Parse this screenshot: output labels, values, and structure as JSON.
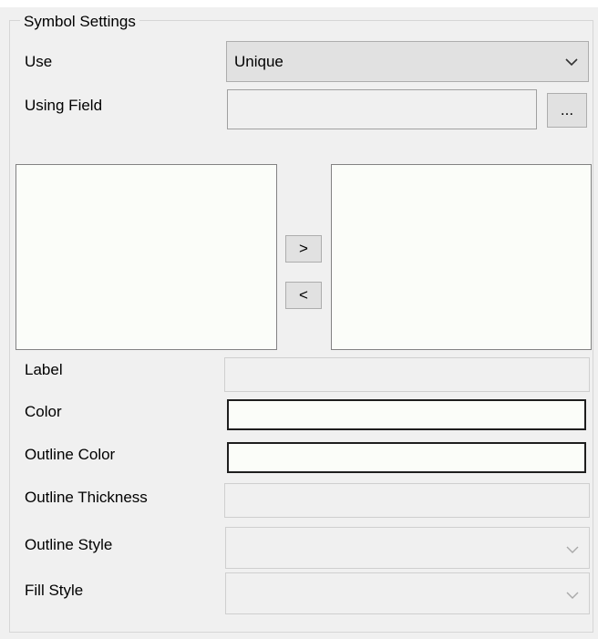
{
  "group": {
    "title": "Symbol Settings"
  },
  "use": {
    "label": "Use",
    "value": "Unique"
  },
  "using_field": {
    "label": "Using Field",
    "value": "",
    "browse_label": "..."
  },
  "transfer": {
    "add_label": ">",
    "remove_label": "<"
  },
  "label_field": {
    "label": "Label",
    "value": ""
  },
  "color": {
    "label": "Color",
    "value": "#fbfdf9"
  },
  "outline_color": {
    "label": "Outline Color",
    "value": "#fbfdf9"
  },
  "outline_thickness": {
    "label": "Outline Thickness",
    "value": ""
  },
  "outline_style": {
    "label": "Outline Style",
    "value": ""
  },
  "fill_style": {
    "label": "Fill Style",
    "value": ""
  }
}
